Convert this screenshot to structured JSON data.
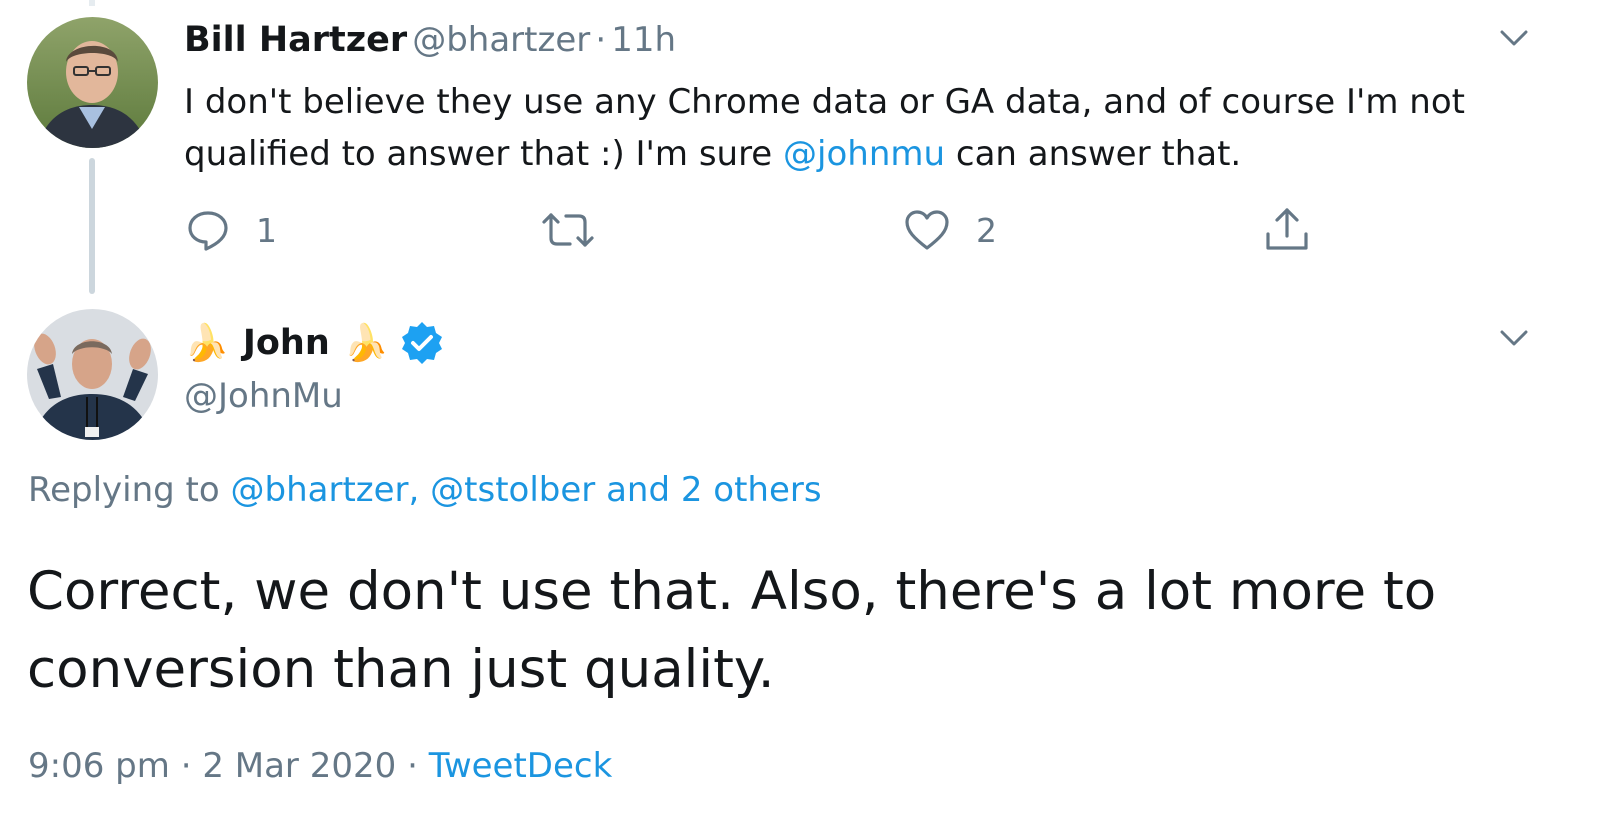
{
  "parent_tweet": {
    "author_name": "Bill Hartzer",
    "handle": "@bhartzer",
    "separator": "·",
    "time": "11h",
    "text_line1": "I don't believe they use any Chrome data or GA data, and of course I'm not",
    "text_line2_pre": "qualified to answer that :) I'm sure ",
    "text_mention": "@johnmu",
    "text_line2_post": " can answer that.",
    "reply_count": "1",
    "like_count": "2",
    "icons": {
      "reply": "reply-icon",
      "retweet": "retweet-icon",
      "like": "heart-icon",
      "share": "share-icon",
      "menu": "chevron-down-icon"
    }
  },
  "main_tweet": {
    "author_name": "John",
    "name_prefix_emoji": "🍌",
    "name_suffix_emoji": "🍌",
    "handle": "@JohnMu",
    "replying_label": "Replying to ",
    "reply_mention_1": "@bhartzer",
    "reply_comma": ", ",
    "reply_mention_2": "@tstolber",
    "reply_others": " and 2 others",
    "text_line1": "Correct, we don't use that. Also, there's a lot more to",
    "text_line2": "conversion than just quality.",
    "time": "9:06 pm",
    "separator": "·",
    "date": "2 Mar 2020",
    "separator2": "·",
    "source": "TweetDeck",
    "icons": {
      "verified": "verified-badge-icon",
      "menu": "chevron-down-icon"
    }
  },
  "colors": {
    "text": "#14171a",
    "muted": "#657786",
    "link": "#1b95e0",
    "thread_line": "#ccd6dd",
    "verified": "#1da1f2"
  }
}
